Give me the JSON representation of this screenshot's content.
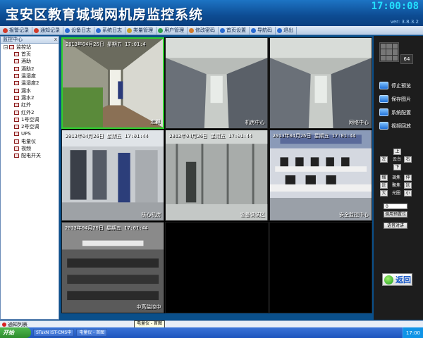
{
  "header": {
    "title": "宝安区教育城域网机房监控系统",
    "clock": "17:00:08",
    "version": "ver: 3.8.3.2"
  },
  "toolbar": {
    "items": [
      {
        "label": "报警记录",
        "icon": "alarm-record-icon",
        "color": "#d23b2a"
      },
      {
        "label": "通知记录",
        "icon": "notice-record-icon",
        "color": "#d23b2a"
      },
      {
        "label": "设备日志",
        "icon": "device-log-icon",
        "color": "#2a6bd2"
      },
      {
        "label": "系统日志",
        "icon": "system-log-icon",
        "color": "#2a6bd2"
      },
      {
        "label": "类量管理",
        "icon": "category-manage-icon",
        "color": "#c8a02a"
      },
      {
        "label": "用户管理",
        "icon": "user-manage-icon",
        "color": "#2aa04a"
      },
      {
        "label": "修改密码",
        "icon": "password-icon",
        "color": "#d27a2a"
      },
      {
        "label": "首页设置",
        "icon": "home-settings-icon",
        "color": "#2a6bd2"
      },
      {
        "label": "导航码",
        "icon": "nav-code-icon",
        "color": "#2a6bd2"
      },
      {
        "label": "退出",
        "icon": "exit-icon",
        "color": "#2a6bd2"
      }
    ]
  },
  "sidebar": {
    "title": "监控中心",
    "close": "x",
    "root": "监控站",
    "items": [
      "首页",
      "酒助",
      "酒助2",
      "温湿度",
      "温湿度2",
      "漏水",
      "漏水2",
      "红外",
      "红外2",
      "1号空调",
      "2号空调",
      "UPS",
      "电量仪",
      "视频",
      "配电开关"
    ]
  },
  "video": {
    "tiles": [
      {
        "timestamp": "2013年04月26日 星期五 17:01:4",
        "caption": "走廊",
        "active": true,
        "scene": "corridor"
      },
      {
        "timestamp": "",
        "caption": "机房中心",
        "active": false,
        "scene": "racks"
      },
      {
        "timestamp": "",
        "caption": "网络中心",
        "active": false,
        "scene": "racks"
      },
      {
        "timestamp": "2013年04月26日 星期五 17:01:44",
        "caption": "核心机房",
        "active": false,
        "scene": "room"
      },
      {
        "timestamp": "2013年04月26日 星期五 17:01:44",
        "caption": "设备调试区",
        "active": false,
        "scene": "glass"
      },
      {
        "timestamp": "2013年04月26日 星期五 17:01:44",
        "caption": "安全监控中心",
        "active": false,
        "scene": "control"
      },
      {
        "timestamp": "2013年04月26日 星期五 17:01:44",
        "caption": "中高监控中",
        "active": false,
        "scene": "night"
      },
      {
        "timestamp": "",
        "caption": "",
        "active": false,
        "scene": "empty"
      },
      {
        "timestamp": "",
        "caption": "",
        "active": false,
        "scene": "empty"
      }
    ]
  },
  "panel": {
    "layout_count": "64",
    "buttons": [
      "停止预览",
      "保存图片",
      "系统配置",
      "视频回放"
    ],
    "ptz": {
      "up": "上",
      "down": "下",
      "left": "左",
      "right": "右",
      "center": "云台",
      "zoom_minus": "缩",
      "zoom_label": "调焦",
      "zoom_plus": "伸",
      "focus_near": "近",
      "focus_label": "聚焦",
      "focus_far": "远",
      "iris_big": "大",
      "iris_label": "光圈",
      "iris_small": "小"
    },
    "preset_value": "0",
    "preset_button": "调用预置位",
    "voice_button": "语音对讲",
    "back_label": "返回"
  },
  "notify": {
    "label": "通知列表"
  },
  "tooltip": "电量仪 - 首图",
  "taskbar": {
    "start": "开始",
    "tasks": [
      "STuxN iST-CMS中",
      "电量仪 - 首图"
    ],
    "tray_time": "17:00"
  }
}
